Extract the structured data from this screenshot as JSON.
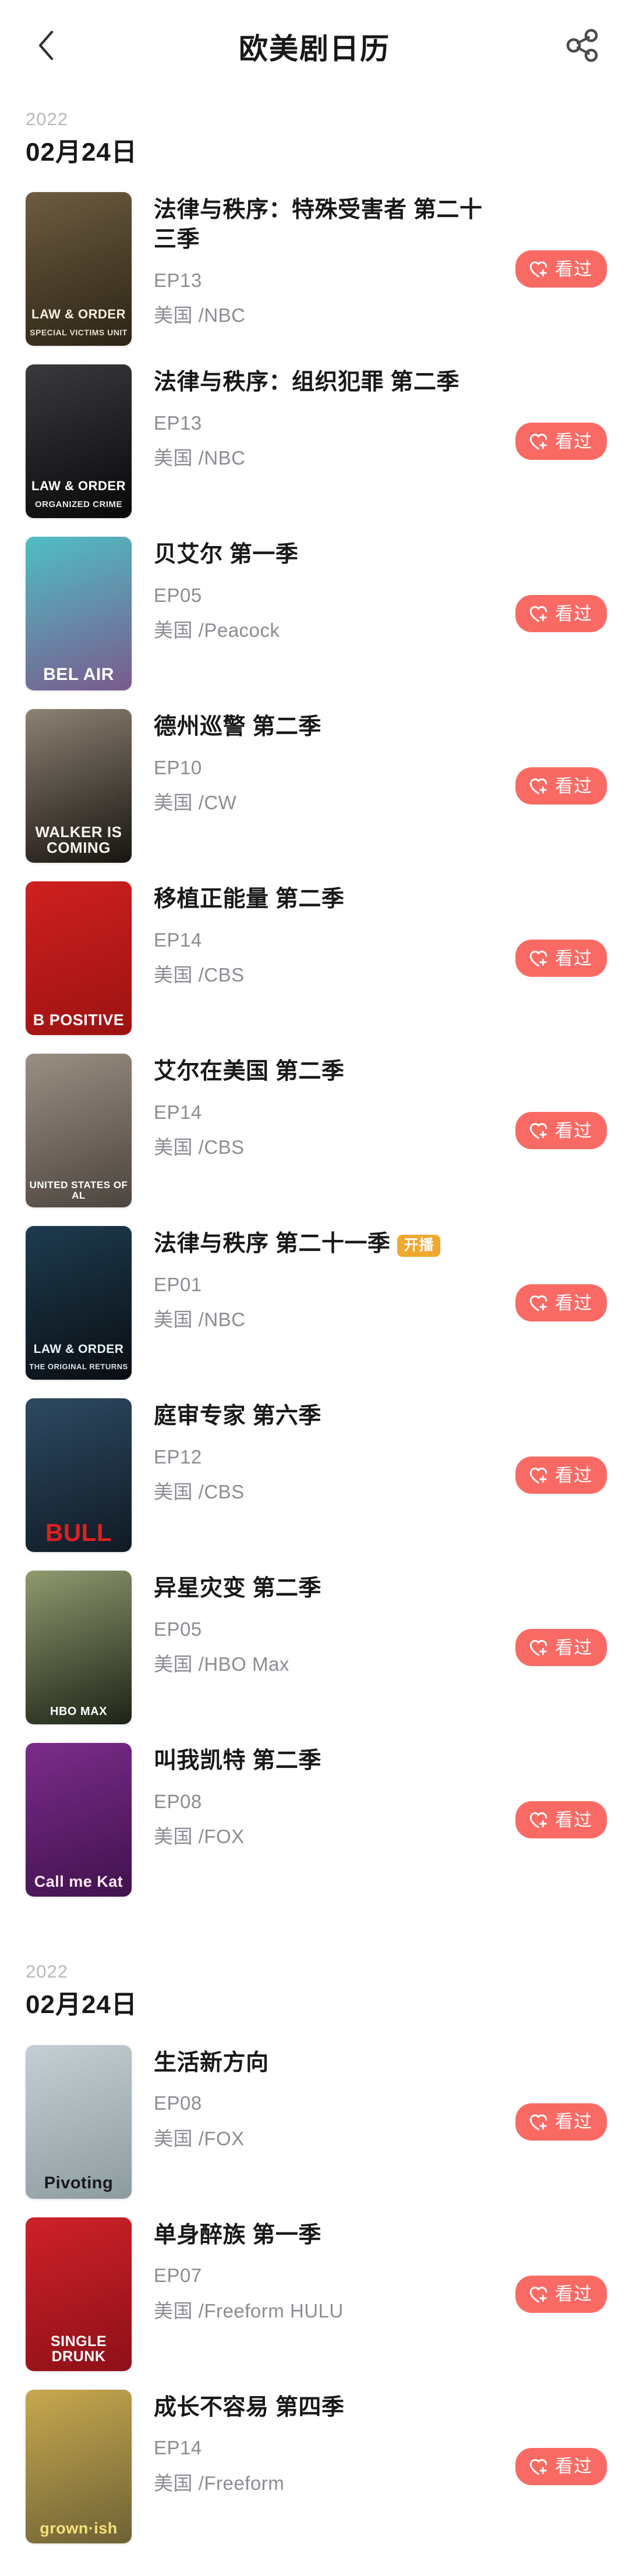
{
  "header": {
    "title": "欧美剧日历",
    "back_icon": "chevron-left-icon",
    "share_icon": "share-nodes-icon"
  },
  "action_button": {
    "label": "看过",
    "icon": "heart-plus-icon",
    "color": "#fa6a64"
  },
  "badges": {
    "premiere_label": "开播",
    "premiere_color": "#f0a830"
  },
  "sections": [
    {
      "year": "2022",
      "date": "02月24日",
      "items": [
        {
          "title": "法律与秩序：特殊受害者 第二十三季",
          "episode": "EP13",
          "meta": "美国 /NBC",
          "badge": "",
          "poster": {
            "caption": "LAW & ORDER",
            "sub": "SPECIAL VICTIMS UNIT",
            "bg1": "#6d5c3f",
            "bg2": "#2c2416",
            "fg": "#f4efe2",
            "fs": 22,
            "subfs": 14
          }
        },
        {
          "title": "法律与秩序：组织犯罪 第二季",
          "episode": "EP13",
          "meta": "美国 /NBC",
          "badge": "",
          "poster": {
            "caption": "LAW & ORDER",
            "sub": "ORGANIZED CRIME",
            "bg1": "#3a3a3c",
            "bg2": "#08080a",
            "fg": "#ffffff",
            "fs": 22,
            "subfs": 15
          }
        },
        {
          "title": "贝艾尔 第一季",
          "episode": "EP05",
          "meta": "美国 /Peacock",
          "badge": "",
          "poster": {
            "caption": "BEL AIR",
            "sub": "",
            "bg1": "#4fbfc4",
            "bg2": "#7a5a8e",
            "fg": "#ffffff",
            "fs": 30,
            "subfs": 13
          }
        },
        {
          "title": "德州巡警 第二季",
          "episode": "EP10",
          "meta": "美国 /CW",
          "badge": "",
          "poster": {
            "caption": "WALKER IS COMING",
            "sub": "",
            "bg1": "#8d8274",
            "bg2": "#17140f",
            "fg": "#f6f3ec",
            "fs": 26,
            "subfs": 13
          }
        },
        {
          "title": "移植正能量 第二季",
          "episode": "EP14",
          "meta": "美国 /CBS",
          "badge": "",
          "poster": {
            "caption": "B POSITIVE",
            "sub": "",
            "bg1": "#cf2020",
            "bg2": "#9c1212",
            "fg": "#ffffff",
            "fs": 27,
            "subfs": 13
          }
        },
        {
          "title": "艾尔在美国 第二季",
          "episode": "EP14",
          "meta": "美国 /CBS",
          "badge": "",
          "poster": {
            "caption": "UNITED STATES OF AL",
            "sub": "",
            "bg1": "#9a8f84",
            "bg2": "#4b443d",
            "fg": "#ffffff",
            "fs": 17,
            "subfs": 13
          }
        },
        {
          "title": "法律与秩序 第二十一季",
          "episode": "EP01",
          "meta": "美国 /NBC",
          "badge": "开播",
          "poster": {
            "caption": "LAW & ORDER",
            "sub": "THE ORIGINAL RETURNS",
            "bg1": "#1d3c50",
            "bg2": "#0a0d11",
            "fg": "#e9f4fb",
            "fs": 21,
            "subfs": 13
          }
        },
        {
          "title": "庭审专家 第六季",
          "episode": "EP12",
          "meta": "美国 /CBS",
          "badge": "",
          "poster": {
            "caption": "BULL",
            "sub": "",
            "bg1": "#2d4a63",
            "bg2": "#101a24",
            "fg": "#e02020",
            "fs": 42,
            "subfs": 13
          }
        },
        {
          "title": "异星灾变 第二季",
          "episode": "EP05",
          "meta": "美国 /HBO Max",
          "badge": "",
          "poster": {
            "caption": "HBO MAX",
            "sub": "",
            "bg1": "#8f9a6e",
            "bg2": "#1d2418",
            "fg": "#ffffff",
            "fs": 20,
            "subfs": 13
          }
        },
        {
          "title": "叫我凯特 第二季",
          "episode": "EP08",
          "meta": "美国 /FOX",
          "badge": "",
          "poster": {
            "caption": "Call me Kat",
            "sub": "",
            "bg1": "#7b2c8a",
            "bg2": "#40124d",
            "fg": "#ffe9f6",
            "fs": 27,
            "subfs": 13
          }
        }
      ]
    },
    {
      "year": "2022",
      "date": "02月24日",
      "items": [
        {
          "title": "生活新方向",
          "episode": "EP08",
          "meta": "美国 /FOX",
          "badge": "",
          "poster": {
            "caption": "Pivoting",
            "sub": "",
            "bg1": "#c6cfd2",
            "bg2": "#8d9ba0",
            "fg": "#16181a",
            "fs": 29,
            "subfs": 13
          }
        },
        {
          "title": "单身醉族 第一季",
          "episode": "EP07",
          "meta": "美国 /Freeform HULU",
          "badge": "",
          "poster": {
            "caption": "SINGLE DRUNK",
            "sub": "",
            "bg1": "#cf2129",
            "bg2": "#8d1018",
            "fg": "#ffffff",
            "fs": 25,
            "subfs": 13
          }
        },
        {
          "title": "成长不容易 第四季",
          "episode": "EP14",
          "meta": "美国 /Freeform",
          "badge": "",
          "poster": {
            "caption": "grown·ish",
            "sub": "",
            "bg1": "#c8a84e",
            "bg2": "#6d6236",
            "fg": "#f6e27a",
            "fs": 27,
            "subfs": 13
          }
        }
      ]
    }
  ]
}
